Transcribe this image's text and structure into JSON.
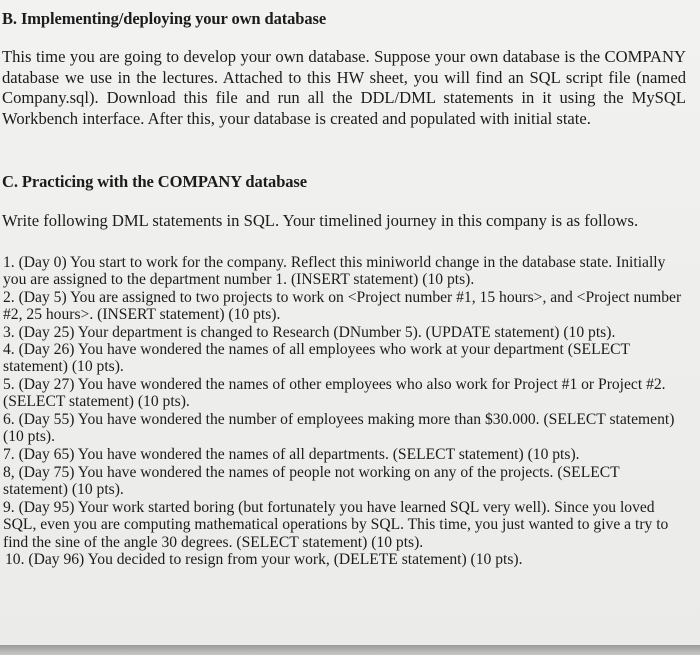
{
  "document": {
    "section_b": {
      "heading": "B. Implementing/deploying your own database",
      "paragraph": "This time you are going to develop your own database. Suppose your own database is the COMPANY database we use in the lectures. Attached to this HW sheet, you will find an SQL script file (named Company.sql). Download this file and run all the DDL/DML statements in it using the MySQL Workbench interface. After this, your database is created and populated with initial state."
    },
    "section_c": {
      "heading": "C. Practicing with the COMPANY database",
      "instructions": "Write following DML statements in SQL. Your timelined journey in this company is as follows.",
      "tasks": [
        {
          "text": "1. (Day 0) You start to work for the company. Reflect this miniworld change in the database state. Initially you are assigned to the department number 1. (INSERT statement) (10 pts)."
        },
        {
          "text": "2. (Day 5) You are assigned to two projects to work on <Project number #1, 15 hours>, and <Project number #2, 25 hours>. (INSERT statement) (10 pts)."
        },
        {
          "text": "3. (Day 25) Your department is changed to Research (DNumber 5). (UPDATE statement) (10 pts)."
        },
        {
          "text": "4. (Day 26) You have wondered the names of all employees who work at your department (SELECT statement) (10 pts)."
        },
        {
          "text": "5. (Day 27) You have wondered the names of other employees who also work for Project #1 or Project #2. (SELECT statement) (10 pts)."
        },
        {
          "text": "6. (Day 55) You have wondered the number of employees making more than $30.000. (SELECT statement) (10 pts)."
        },
        {
          "text": "7. (Day 65) You have wondered the names of all departments. (SELECT statement) (10 pts)."
        },
        {
          "text": "8, (Day 75) You have wondered the names of people not working on any of the projects. (SELECT statement) (10 pts)."
        },
        {
          "text": "9. (Day 95) Your work started boring (but fortunately you have learned SQL very well). Since you loved SQL, even you are computing mathematical operations by SQL. This time, you just wanted to give a try to find the sine of the angle 30 degrees. (SELECT statement) (10 pts)."
        },
        {
          "text": "10. (Day 96) You decided to resign from your work, (DELETE statement) (10 pts)."
        }
      ]
    }
  }
}
